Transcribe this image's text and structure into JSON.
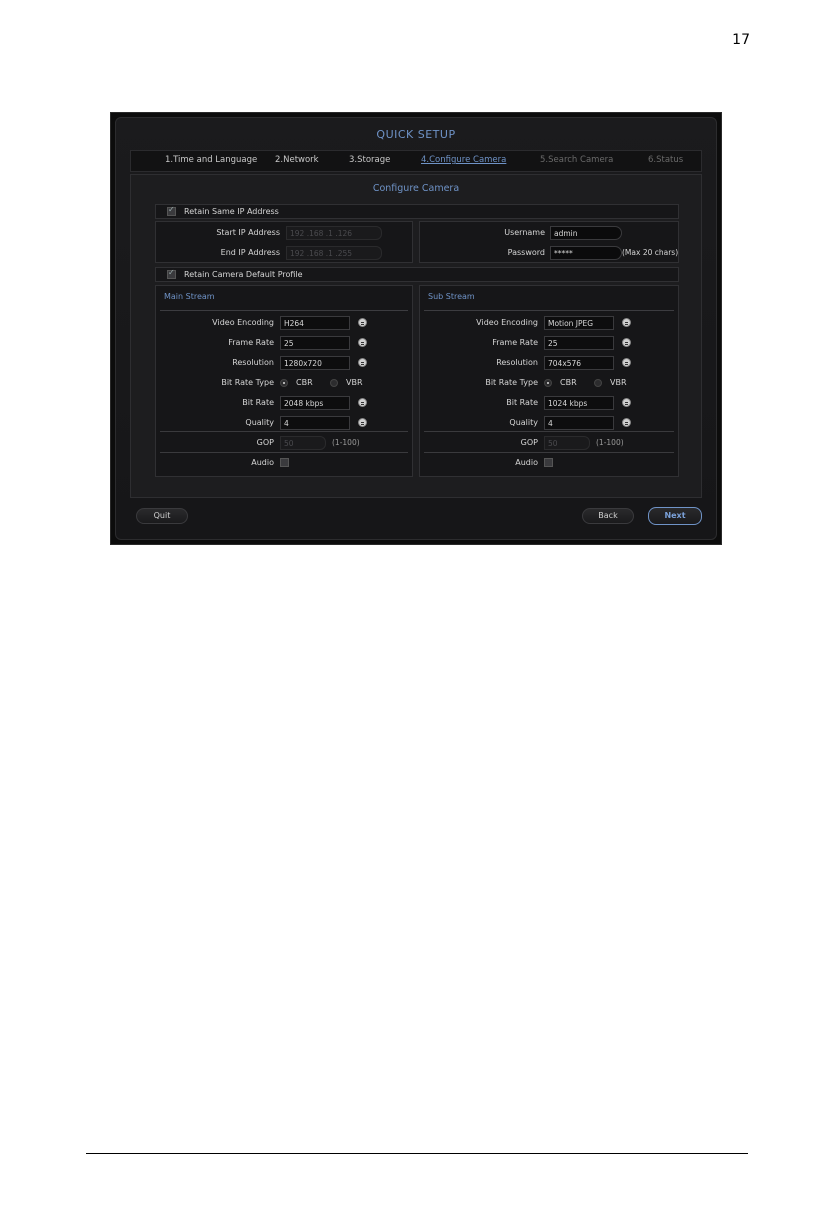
{
  "page_number": "17",
  "window": {
    "title": "QUICK SETUP"
  },
  "steps": [
    {
      "label": "1.Time and Language"
    },
    {
      "label": "2.Network"
    },
    {
      "label": "3.Storage"
    },
    {
      "label": "4.Configure Camera"
    },
    {
      "label": "5.Search Camera"
    },
    {
      "label": "6.Status"
    }
  ],
  "configure": {
    "title": "Configure Camera",
    "retain_ip_label": "Retain Same IP Address",
    "start_ip_label": "Start IP Address",
    "start_ip_value": "192 .168 .1 .126",
    "end_ip_label": "End IP Address",
    "end_ip_value": "192 .168 .1 .255",
    "username_label": "Username",
    "username_value": "admin",
    "password_label": "Password",
    "password_value": "*****",
    "password_hint": "(Max 20 chars)",
    "retain_profile_label": "Retain Camera Default Profile"
  },
  "labels": {
    "video_encoding": "Video Encoding",
    "frame_rate": "Frame Rate",
    "resolution": "Resolution",
    "bit_rate_type": "Bit Rate Type",
    "cbr": "CBR",
    "vbr": "VBR",
    "bit_rate": "Bit Rate",
    "quality": "Quality",
    "gop": "GOP",
    "gop_range": "(1-100)",
    "audio": "Audio"
  },
  "main_stream": {
    "title": "Main Stream",
    "video_encoding": "H264",
    "frame_rate": "25",
    "resolution": "1280x720",
    "bit_rate_type": "CBR",
    "bit_rate": "2048 kbps",
    "quality": "4",
    "gop": "50"
  },
  "sub_stream": {
    "title": "Sub Stream",
    "video_encoding": "Motion JPEG",
    "frame_rate": "25",
    "resolution": "704x576",
    "bit_rate_type": "CBR",
    "bit_rate": "1024 kbps",
    "quality": "4",
    "gop": "50"
  },
  "buttons": {
    "quit": "Quit",
    "back": "Back",
    "next": "Next"
  }
}
